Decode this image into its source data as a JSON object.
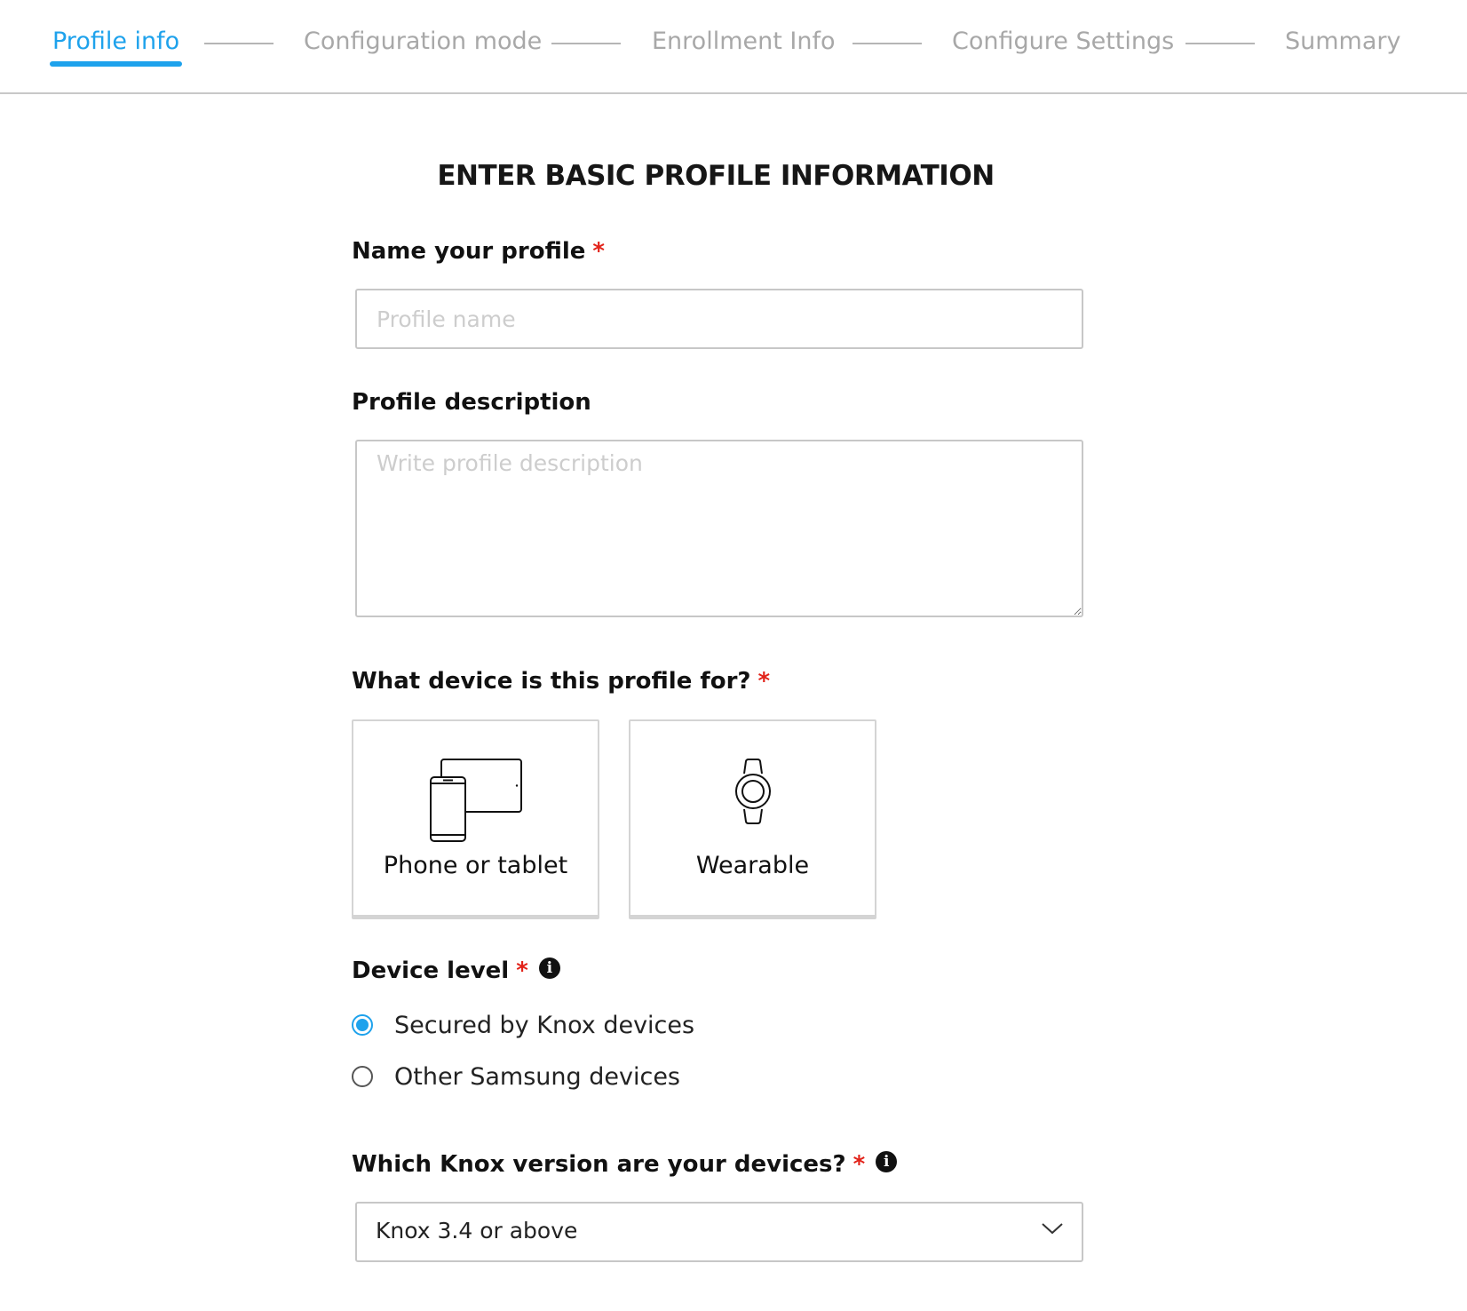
{
  "stepper": {
    "steps": [
      {
        "label": "Profile info",
        "active": true
      },
      {
        "label": "Configuration mode",
        "active": false
      },
      {
        "label": "Enrollment Info",
        "active": false
      },
      {
        "label": "Configure Settings",
        "active": false
      },
      {
        "label": "Summary",
        "active": false
      }
    ]
  },
  "page_title": "ENTER BASIC PROFILE INFORMATION",
  "profile_name": {
    "label": "Name your profile",
    "required_mark": "*",
    "value": "",
    "placeholder": "Profile name"
  },
  "profile_description": {
    "label": "Profile description",
    "value": "",
    "placeholder": "Write profile description"
  },
  "device_type": {
    "label": "What device is this profile for?",
    "required_mark": "*",
    "options": [
      {
        "label": "Phone or tablet",
        "icon": "phone-tablet-icon"
      },
      {
        "label": "Wearable",
        "icon": "smartwatch-icon"
      }
    ]
  },
  "device_level": {
    "label": "Device level",
    "required_mark": "*",
    "info_icon": "i",
    "options": [
      {
        "label": "Secured by Knox devices",
        "selected": true
      },
      {
        "label": "Other Samsung devices",
        "selected": false
      }
    ]
  },
  "knox_version": {
    "label": "Which Knox version are your devices?",
    "required_mark": "*",
    "info_icon": "i",
    "selected": "Knox 3.4 or above"
  },
  "colors": {
    "accent": "#1ea2ec",
    "required": "#e2231a",
    "inactive_step": "#a8a8a8",
    "border": "#c7c7c7"
  }
}
